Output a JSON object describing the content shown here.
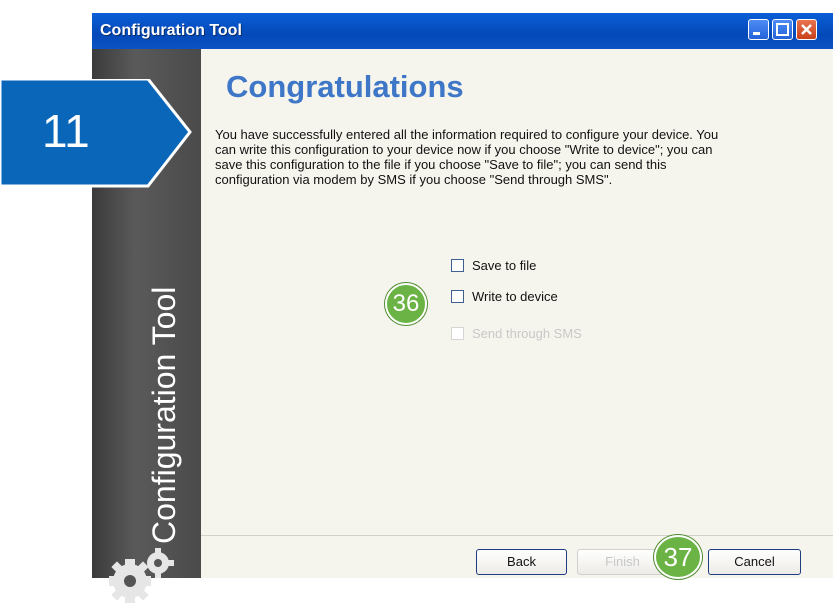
{
  "window": {
    "title": "Configuration Tool",
    "controls": {
      "minimize_icon": "minimize-icon",
      "maximize_icon": "maximize-icon",
      "close_icon": "close-icon"
    }
  },
  "sidebar": {
    "label": "Configuration Tool",
    "icon": "gears-icon"
  },
  "page": {
    "heading": "Congratulations",
    "description": "You have successfully entered all the information required to configure your device. You can write this configuration to your device now if you choose \"Write to device\"; you can save this configuration to the file if you choose \"Save to file\"; you can send this configuration via modem by SMS if you choose \"Send through SMS\"."
  },
  "options": [
    {
      "label": "Save to file",
      "checked": false,
      "enabled": true
    },
    {
      "label": "Write to device",
      "checked": false,
      "enabled": true
    },
    {
      "label": "Send through SMS",
      "checked": false,
      "enabled": false
    }
  ],
  "buttons": {
    "back": "Back",
    "finish": "Finish",
    "cancel": "Cancel"
  },
  "annotations": {
    "step": "11",
    "callout_options": "36",
    "callout_finish": "37"
  },
  "colors": {
    "title_bar": "#0449b8",
    "heading": "#3e76c8",
    "step_arrow": "#0a66b8",
    "callout": "#6bb344"
  }
}
